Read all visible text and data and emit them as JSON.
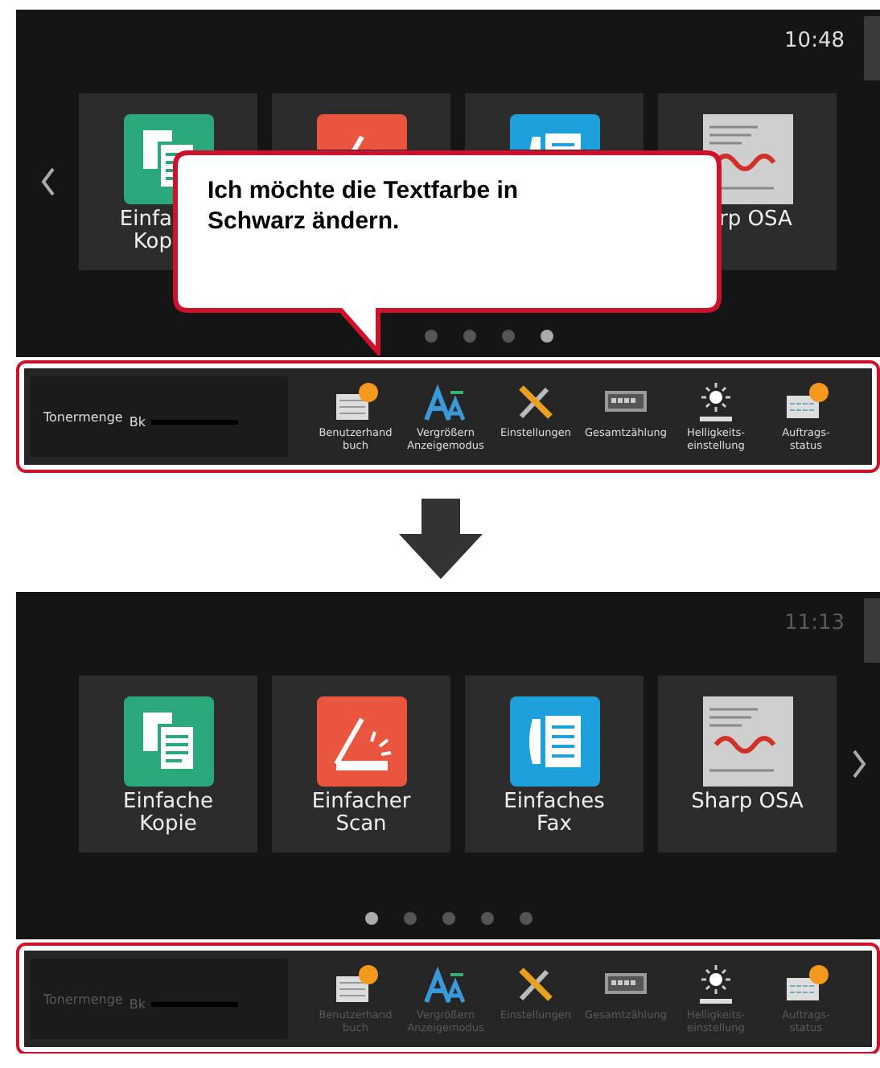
{
  "screens": [
    {
      "time": "10:48",
      "dark_text": false,
      "prev_arrow": true,
      "next_arrow": false,
      "tiles": [
        {
          "kind": "copy",
          "label_lines": [
            "Einfa",
            "Kop"
          ]
        },
        {
          "kind": "scan"
        },
        {
          "kind": "fax"
        },
        {
          "kind": "osa",
          "label_lines": [
            "rp OSA"
          ]
        }
      ],
      "dots": [
        {
          "selected": false
        },
        {
          "selected": false
        },
        {
          "selected": false
        },
        {
          "selected": true
        }
      ],
      "toner": {
        "label": "Tonermenge",
        "color_label": "Bk"
      },
      "tools": [
        {
          "kind": "manual",
          "label_lines": [
            "Benutzerhand",
            "buch"
          ]
        },
        {
          "kind": "zoom",
          "label_lines": [
            "Vergrößern",
            "Anzeigemodus"
          ]
        },
        {
          "kind": "settings",
          "label_lines": [
            "Einstellungen"
          ]
        },
        {
          "kind": "counter",
          "label_lines": [
            "Gesamtzählung"
          ]
        },
        {
          "kind": "brightness",
          "label_lines": [
            "Helligkeits-",
            "einstellung"
          ]
        },
        {
          "kind": "jobs",
          "label_lines": [
            "Auftrags-",
            "status"
          ]
        }
      ],
      "callout": {
        "text_lines": [
          "Ich möchte die Textfarbe in",
          "Schwarz ändern."
        ]
      }
    },
    {
      "time": "11:13",
      "dark_text": true,
      "prev_arrow": false,
      "next_arrow": true,
      "tiles": [
        {
          "kind": "copy",
          "label_lines": [
            "Einfache",
            "Kopie"
          ]
        },
        {
          "kind": "scan",
          "label_lines": [
            "Einfacher",
            "Scan"
          ]
        },
        {
          "kind": "fax",
          "label_lines": [
            "Einfaches",
            "Fax"
          ]
        },
        {
          "kind": "osa",
          "label_lines": [
            "Sharp OSA"
          ]
        }
      ],
      "dots": [
        {
          "selected": true
        },
        {
          "selected": false
        },
        {
          "selected": false
        },
        {
          "selected": false
        },
        {
          "selected": false
        }
      ],
      "toner": {
        "label": "Tonermenge",
        "color_label": "Bk"
      },
      "tools": [
        {
          "kind": "manual",
          "label_lines": [
            "Benutzerhand",
            "buch"
          ]
        },
        {
          "kind": "zoom",
          "label_lines": [
            "Vergrößern",
            "Anzeigemodus"
          ]
        },
        {
          "kind": "settings",
          "label_lines": [
            "Einstellungen"
          ]
        },
        {
          "kind": "counter",
          "label_lines": [
            "Gesamtzählung"
          ]
        },
        {
          "kind": "brightness",
          "label_lines": [
            "Helligkeits-",
            "einstellung"
          ]
        },
        {
          "kind": "jobs",
          "label_lines": [
            "Auftrags-",
            "status"
          ]
        }
      ]
    }
  ]
}
